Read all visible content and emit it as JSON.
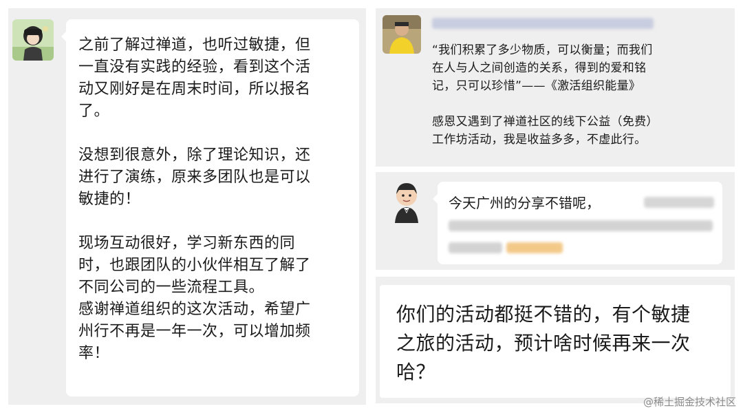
{
  "left_message": {
    "text": "之前了解过禅道，也听过敏捷，但\n一直没有实践的经验，看到这个活\n动又刚好是在周末时间，所以报名\n了。\n\n没想到很意外，除了理论知识，还\n进行了演练，原来多团队也是可以\n敏捷的！\n\n现场互动很好，学习新东西的同\n时，也跟团队的小伙伴相互了解了\n不同公司的一些流程工具。\n感谢禅道组织的这次活动，希望广\n州行不再是一年一次，可以增加频\n率！"
  },
  "top_right_post": {
    "text": "“我们积累了多少物质，可以衡量；而我们\n在人与人之间创造的关系，得到的爱和铭\n记，只可以珍惜”——《激活组织能量》\n\n感恩又遇到了禅道社区的线下公益（免费）\n工作坊活动，我是收益多多，不虚此行。"
  },
  "middle_right_message": {
    "text": "今天广州的分享不错呢，"
  },
  "bottom_right_message": {
    "text": "你们的活动都挺不错的，有个敏捷\n之旅的活动，预计啥时候再来一次\n哈？"
  },
  "watermark": {
    "text": "@稀土掘金技术社区"
  }
}
